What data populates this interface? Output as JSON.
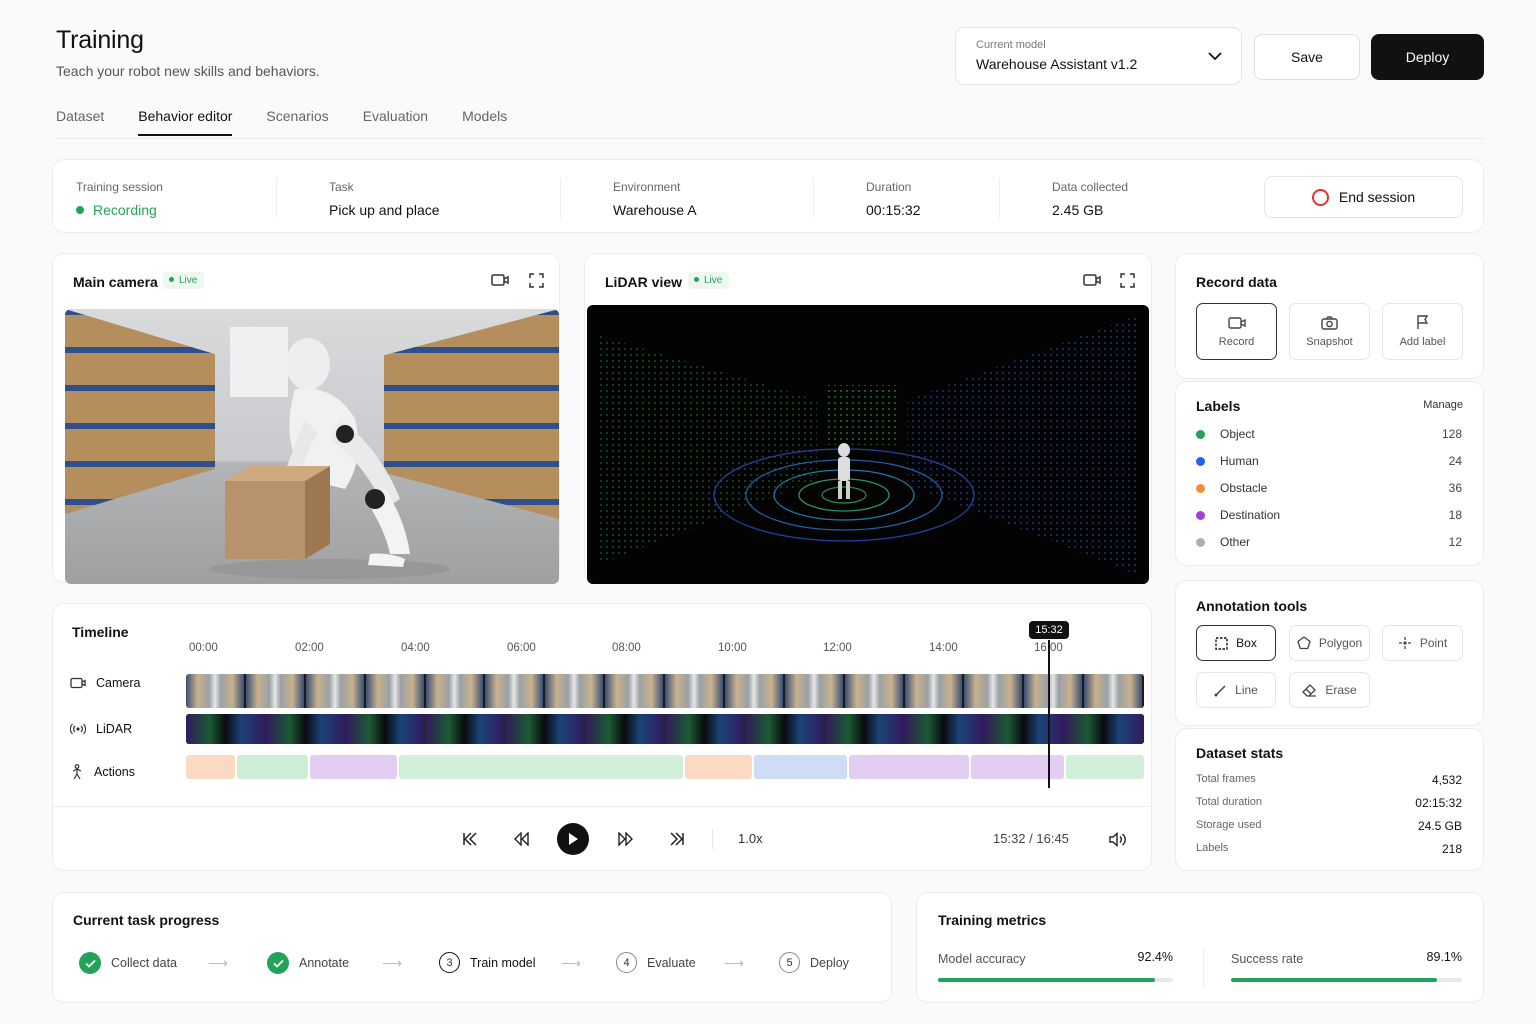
{
  "header": {
    "title": "Training",
    "subtitle": "Teach your robot new skills and behaviors.",
    "model_select": {
      "label": "Current model",
      "value": "Warehouse Assistant v1.2"
    },
    "save_label": "Save",
    "deploy_label": "Deploy"
  },
  "tabs": [
    {
      "label": "Dataset"
    },
    {
      "label": "Behavior editor",
      "active": true
    },
    {
      "label": "Scenarios"
    },
    {
      "label": "Evaluation"
    },
    {
      "label": "Models"
    }
  ],
  "session": {
    "training_session": {
      "label": "Training session",
      "value": "Recording"
    },
    "task": {
      "label": "Task",
      "value": "Pick up and place"
    },
    "environment": {
      "label": "Environment",
      "value": "Warehouse A"
    },
    "duration": {
      "label": "Duration",
      "value": "00:15:32"
    },
    "data_collected": {
      "label": "Data collected",
      "value": "2.45 GB"
    },
    "end_label": "End session"
  },
  "main_camera": {
    "title": "Main camera",
    "live": "Live"
  },
  "lidar": {
    "title": "LiDAR view",
    "live": "Live"
  },
  "record_data": {
    "title": "Record data",
    "buttons": [
      {
        "label": "Record",
        "icon": "video-icon"
      },
      {
        "label": "Snapshot",
        "icon": "camera-icon"
      },
      {
        "label": "Add label",
        "icon": "flag-icon"
      }
    ]
  },
  "labels": {
    "title": "Labels",
    "manage": "Manage",
    "items": [
      {
        "name": "Object",
        "count": "128",
        "color": "#22a35a"
      },
      {
        "name": "Human",
        "count": "24",
        "color": "#2563eb"
      },
      {
        "name": "Obstacle",
        "count": "36",
        "color": "#f28c38"
      },
      {
        "name": "Destination",
        "count": "18",
        "color": "#a33fd6"
      },
      {
        "name": "Other",
        "count": "12",
        "color": "#b0b0b0"
      }
    ]
  },
  "annotation_tools": {
    "title": "Annotation tools",
    "tools": [
      {
        "label": "Box",
        "icon": "box-icon"
      },
      {
        "label": "Polygon",
        "icon": "polygon-icon"
      },
      {
        "label": "Point",
        "icon": "point-icon"
      },
      {
        "label": "Line",
        "icon": "line-icon"
      },
      {
        "label": "Erase",
        "icon": "eraser-icon"
      }
    ]
  },
  "dataset_stats": {
    "title": "Dataset stats",
    "rows": [
      {
        "label": "Total frames",
        "value": "4,532"
      },
      {
        "label": "Total duration",
        "value": "02:15:32"
      },
      {
        "label": "Storage used",
        "value": "24.5 GB"
      },
      {
        "label": "Labels",
        "value": "218"
      }
    ]
  },
  "timeline": {
    "title": "Timeline",
    "ticks": [
      "00:00",
      "02:00",
      "04:00",
      "06:00",
      "08:00",
      "10:00",
      "12:00",
      "14:00",
      "16:00"
    ],
    "playhead": "15:32",
    "tracks": [
      "Camera",
      "LiDAR",
      "Actions"
    ],
    "speed": "1.0x",
    "time": "15:32 / 16:45"
  },
  "progress": {
    "title": "Current task progress",
    "steps": [
      {
        "label": "Collect data",
        "num": "1",
        "done": true
      },
      {
        "label": "Annotate",
        "num": "2",
        "done": true
      },
      {
        "label": "Train model",
        "num": "3",
        "done": false,
        "current": true
      },
      {
        "label": "Evaluate",
        "num": "4",
        "done": false
      },
      {
        "label": "Deploy",
        "num": "5",
        "done": false
      }
    ]
  },
  "metrics": {
    "title": "Training metrics",
    "accuracy": {
      "label": "Model accuracy",
      "value": "92.4%",
      "fraction": 0.924
    },
    "success": {
      "label": "Success rate",
      "value": "89.1%",
      "fraction": 0.891
    }
  }
}
